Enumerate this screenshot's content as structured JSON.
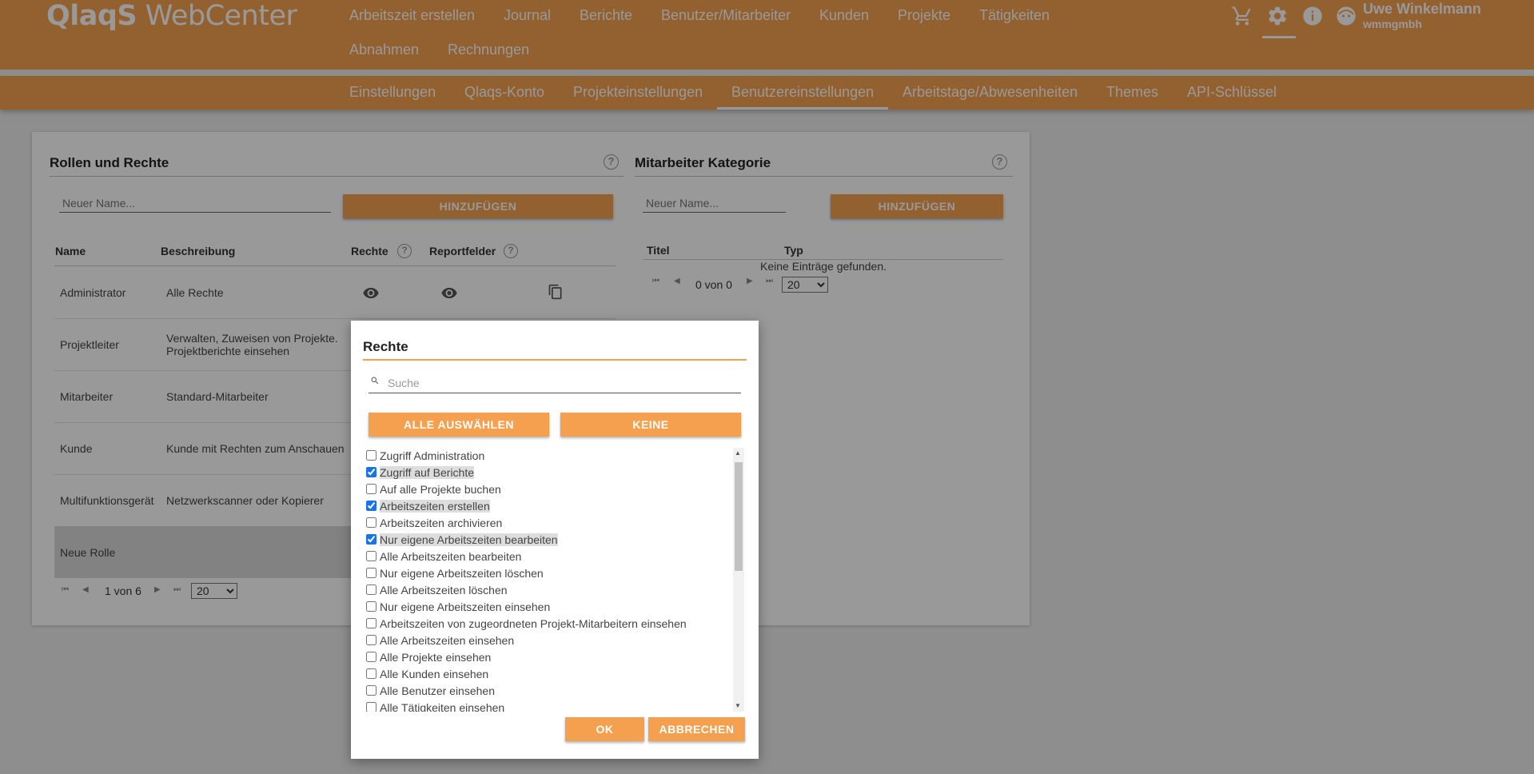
{
  "header": {
    "logo_bold": "QlaqS",
    "logo_light": " WebCenter",
    "nav": [
      "Arbeitszeit erstellen",
      "Journal",
      "Berichte",
      "Benutzer/Mitarbeiter",
      "Kunden",
      "Projekte",
      "Tätigkeiten",
      "Abnahmen",
      "Rechnungen"
    ],
    "user_name": "Uwe Winkelmann",
    "user_org": "wmmgmbh",
    "icons": [
      "cart-icon",
      "gear-icon",
      "info-icon",
      "user-avatar-icon"
    ]
  },
  "subnav": {
    "items": [
      "Einstellungen",
      "Qlaqs-Konto",
      "Projekteinstellungen",
      "Benutzereinstellungen",
      "Arbeitstage/Abwesenheiten",
      "Themes",
      "API-Schlüssel"
    ],
    "active": "Benutzereinstellungen"
  },
  "roles": {
    "title": "Rollen und Rechte",
    "new_name_placeholder": "Neuer Name...",
    "add_label": "HINZUFÜGEN",
    "headers": {
      "name": "Name",
      "description": "Beschreibung",
      "rights": "Rechte",
      "report_fields": "Reportfelder"
    },
    "rows": [
      {
        "name": "Administrator",
        "desc1": "Alle Rechte",
        "desc2": ""
      },
      {
        "name": "Projektleiter",
        "desc1": "Verwalten, Zuweisen von Projekte.",
        "desc2": "Projektberichte einsehen"
      },
      {
        "name": "Mitarbeiter",
        "desc1": "Standard-Mitarbeiter",
        "desc2": ""
      },
      {
        "name": "Kunde",
        "desc1": "Kunde mit Rechten zum Anschauen",
        "desc2": ""
      },
      {
        "name": "Multifunktionsgerät",
        "desc1": "Netzwerkscanner oder Kopierer",
        "desc2": ""
      },
      {
        "name": "Neue Rolle",
        "desc1": "",
        "desc2": ""
      }
    ],
    "pager_text": "1 von 6",
    "page_size": "20"
  },
  "category": {
    "title": "Mitarbeiter Kategorie",
    "new_name_placeholder": "Neuer Name...",
    "add_label": "HINZUFÜGEN",
    "headers": {
      "title": "Titel",
      "type": "Typ"
    },
    "empty_text": "Keine Einträge gefunden.",
    "pager_text": "0 von 0",
    "page_size": "20"
  },
  "dialog": {
    "title": "Rechte",
    "search_placeholder": "Suche",
    "select_all_label": "ALLE AUSWÄHLEN",
    "none_label": "KEINE",
    "ok_label": "OK",
    "cancel_label": "ABBRECHEN",
    "items": [
      {
        "label": "Zugriff Administration",
        "checked": false
      },
      {
        "label": "Zugriff auf Berichte",
        "checked": true
      },
      {
        "label": "Auf alle Projekte buchen",
        "checked": false
      },
      {
        "label": "Arbeitszeiten erstellen",
        "checked": true
      },
      {
        "label": "Arbeitszeiten archivieren",
        "checked": false
      },
      {
        "label": "Nur eigene Arbeitszeiten bearbeiten",
        "checked": true
      },
      {
        "label": "Alle Arbeitszeiten bearbeiten",
        "checked": false
      },
      {
        "label": "Nur eigene Arbeitszeiten löschen",
        "checked": false
      },
      {
        "label": "Alle Arbeitszeiten löschen",
        "checked": false
      },
      {
        "label": "Nur eigene Arbeitszeiten einsehen",
        "checked": false
      },
      {
        "label": "Arbeitszeiten von zugeordneten Projekt-Mitarbeitern einsehen",
        "checked": false
      },
      {
        "label": "Alle Arbeitszeiten einsehen",
        "checked": false
      },
      {
        "label": "Alle Projekte einsehen",
        "checked": false
      },
      {
        "label": "Alle Kunden einsehen",
        "checked": false
      },
      {
        "label": "Alle Benutzer einsehen",
        "checked": false
      },
      {
        "label": "Alle Tätigkeiten einsehen",
        "checked": false
      }
    ]
  },
  "colors": {
    "accent": "#f5a04f",
    "overlay": "rgba(0,0,0,0.40)"
  }
}
